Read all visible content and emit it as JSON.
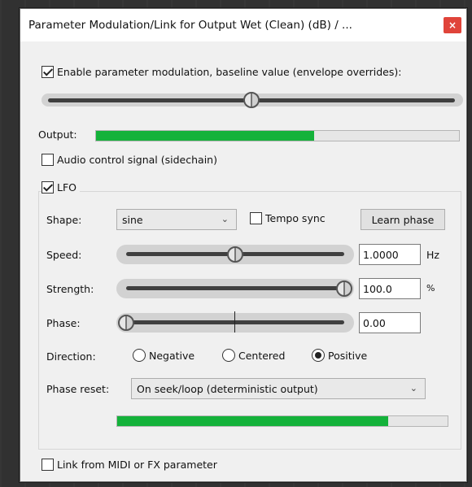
{
  "window": {
    "title": "Parameter Modulation/Link for Output Wet (Clean) (dB) / ...",
    "close_glyph": "×"
  },
  "enable_modulation": {
    "label": "Enable parameter modulation, baseline value (envelope overrides):",
    "checked": true,
    "baseline_value": 0.5
  },
  "output": {
    "label": "Output:",
    "level": 0.6
  },
  "audio_control": {
    "label": "Audio control signal (sidechain)",
    "checked": false
  },
  "lfo": {
    "label": "LFO",
    "checked": true,
    "shape": {
      "label": "Shape:",
      "value": "sine"
    },
    "tempo_sync": {
      "label": "Tempo sync",
      "checked": false
    },
    "learn_phase_label": "Learn phase",
    "speed": {
      "label": "Speed:",
      "value": "1.0000",
      "unit": "Hz",
      "position": 0.5
    },
    "strength": {
      "label": "Strength:",
      "value": "100.0",
      "unit": "%",
      "position": 1.0
    },
    "phase": {
      "label": "Phase:",
      "value": "0.00",
      "position": 0.0
    },
    "direction": {
      "label": "Direction:",
      "options": [
        "Negative",
        "Centered",
        "Positive"
      ],
      "selected": "Positive"
    },
    "phase_reset": {
      "label": "Phase reset:",
      "value": "On seek/loop (deterministic output)"
    },
    "level": 0.82
  },
  "link_midi": {
    "label": "Link from MIDI or FX parameter",
    "checked": false
  },
  "colors": {
    "meter_green": "#14b23a",
    "close_red": "#e0443a"
  }
}
